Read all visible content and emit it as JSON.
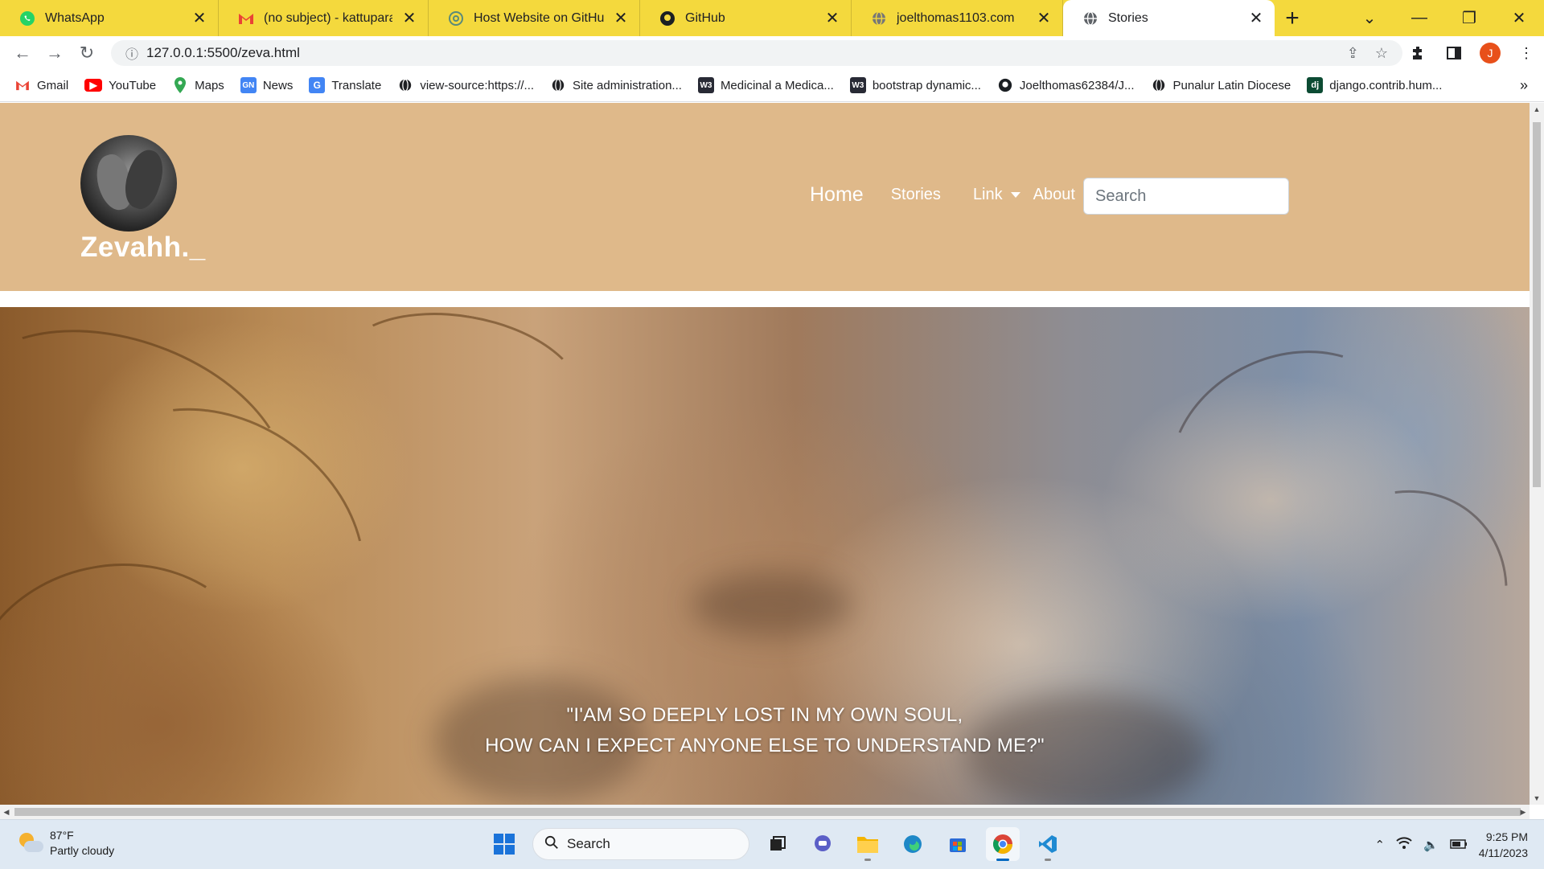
{
  "browser": {
    "tabs": [
      {
        "title": "WhatsApp",
        "icon": "whatsapp-icon",
        "active": false
      },
      {
        "title": "(no subject) - kattuparamb",
        "icon": "gmail-icon",
        "active": false
      },
      {
        "title": "Host Website on GitHub Pa",
        "icon": "chatgpt-icon",
        "active": false
      },
      {
        "title": "GitHub",
        "icon": "github-icon",
        "active": false
      },
      {
        "title": "joelthomas1103.com",
        "icon": "globe-icon",
        "active": false
      },
      {
        "title": "Stories",
        "icon": "globe-icon",
        "active": true
      }
    ],
    "url": "127.0.0.1:5500/zeva.html",
    "profile_initial": "J",
    "bookmarks": [
      {
        "label": "Gmail",
        "icon": "gmail-icon"
      },
      {
        "label": "YouTube",
        "icon": "youtube-icon"
      },
      {
        "label": "Maps",
        "icon": "maps-icon"
      },
      {
        "label": "News",
        "icon": "news-icon"
      },
      {
        "label": "Translate",
        "icon": "translate-icon"
      },
      {
        "label": "view-source:https://...",
        "icon": "globe-icon"
      },
      {
        "label": "Site administration...",
        "icon": "globe-icon"
      },
      {
        "label": "Medicinal a Medica...",
        "icon": "w3schools-icon"
      },
      {
        "label": "bootstrap dynamic...",
        "icon": "w3schools-icon"
      },
      {
        "label": "Joelthomas62384/J...",
        "icon": "github-icon"
      },
      {
        "label": "Punalur Latin Diocese",
        "icon": "globe-icon"
      },
      {
        "label": "django.contrib.hum...",
        "icon": "django-icon"
      }
    ],
    "tab_strip_color": "#f4d93d"
  },
  "site": {
    "brand": "Zevahh._",
    "nav": {
      "home": "Home",
      "stories": "Stories",
      "link": "Link",
      "about": "About"
    },
    "search_placeholder": "Search",
    "header_color": "#dfb98a",
    "quote_line1": "\"I'AM SO DEEPLY LOST IN MY OWN SOUL,",
    "quote_line2": "HOW CAN I EXPECT ANYONE ELSE TO UNDERSTAND ME?\""
  },
  "taskbar": {
    "weather_temp": "87°F",
    "weather_desc": "Partly cloudy",
    "search_label": "Search",
    "time": "9:25 PM",
    "date": "4/11/2023"
  }
}
